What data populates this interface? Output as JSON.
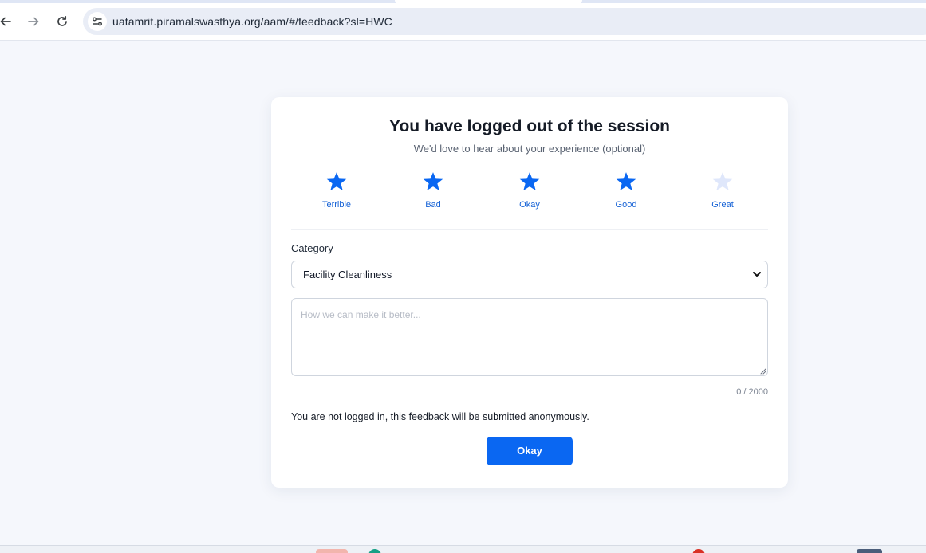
{
  "browser": {
    "url": "uatamrit.piramalswasthya.org/aam/#/feedback?sl=HWC",
    "icons": {
      "back": "arrow-left-icon",
      "forward": "arrow-right-icon",
      "reload": "reload-icon",
      "site_info": "site-settings-icon"
    }
  },
  "card": {
    "title": "You have logged out of the session",
    "subtitle": "We'd love to hear about your experience (optional)",
    "rating": {
      "selected": 4,
      "max": 5,
      "items": [
        {
          "label": "Terrible",
          "filled": true
        },
        {
          "label": "Bad",
          "filled": true
        },
        {
          "label": "Okay",
          "filled": true
        },
        {
          "label": "Good",
          "filled": true
        },
        {
          "label": "Great",
          "filled": false
        }
      ],
      "filled_color": "#0a67f2",
      "empty_color": "#dfe7fb"
    },
    "category": {
      "label": "Category",
      "selected": "Facility Cleanliness"
    },
    "feedback": {
      "placeholder": "How we can make it better...",
      "value": "",
      "char_count": "0 / 2000"
    },
    "anonymous_note": "You are not logged in, this feedback will be submitted anonymously.",
    "okay_button": "Okay"
  },
  "colors": {
    "accent": "#0a67f2",
    "page_background": "#f5f7fc"
  }
}
